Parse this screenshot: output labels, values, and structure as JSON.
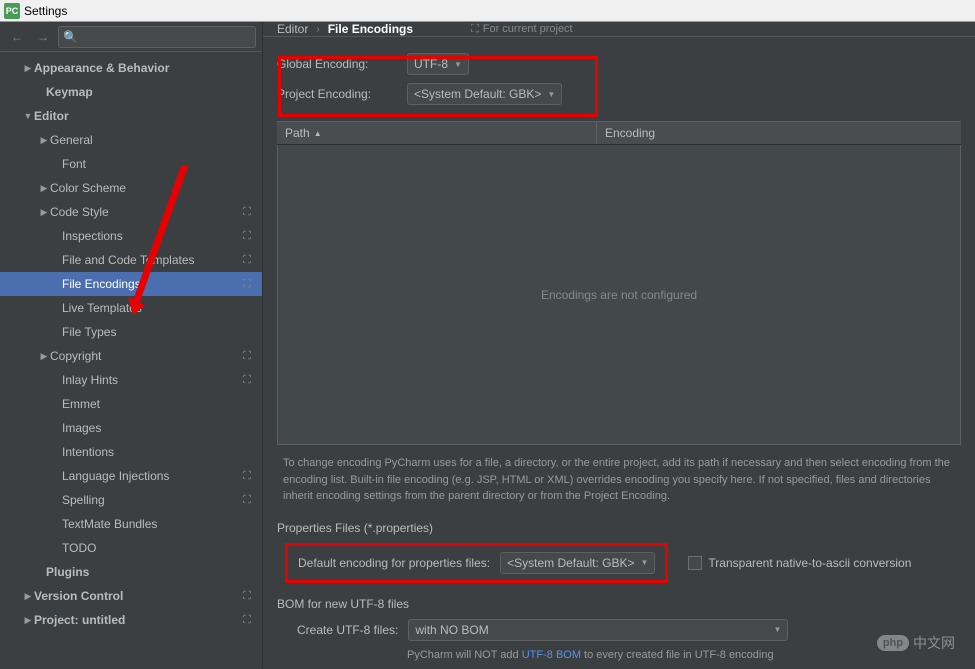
{
  "window": {
    "title": "Settings"
  },
  "search": {
    "placeholder": ""
  },
  "sidebar": {
    "items": [
      {
        "label": "Appearance & Behavior",
        "indent": 22,
        "bold": true,
        "arrow": "▶",
        "icon": ""
      },
      {
        "label": "Keymap",
        "indent": 34,
        "bold": true,
        "arrow": "",
        "icon": ""
      },
      {
        "label": "Editor",
        "indent": 22,
        "bold": true,
        "arrow": "▼",
        "icon": ""
      },
      {
        "label": "General",
        "indent": 38,
        "bold": false,
        "arrow": "▶",
        "icon": ""
      },
      {
        "label": "Font",
        "indent": 50,
        "bold": false,
        "arrow": "",
        "icon": ""
      },
      {
        "label": "Color Scheme",
        "indent": 38,
        "bold": false,
        "arrow": "▶",
        "icon": ""
      },
      {
        "label": "Code Style",
        "indent": 38,
        "bold": false,
        "arrow": "▶",
        "icon": "⛶"
      },
      {
        "label": "Inspections",
        "indent": 50,
        "bold": false,
        "arrow": "",
        "icon": "⛶"
      },
      {
        "label": "File and Code Templates",
        "indent": 50,
        "bold": false,
        "arrow": "",
        "icon": "⛶"
      },
      {
        "label": "File Encodings",
        "indent": 50,
        "bold": false,
        "arrow": "",
        "icon": "⛶",
        "selected": true
      },
      {
        "label": "Live Templates",
        "indent": 50,
        "bold": false,
        "arrow": "",
        "icon": ""
      },
      {
        "label": "File Types",
        "indent": 50,
        "bold": false,
        "arrow": "",
        "icon": ""
      },
      {
        "label": "Copyright",
        "indent": 38,
        "bold": false,
        "arrow": "▶",
        "icon": "⛶"
      },
      {
        "label": "Inlay Hints",
        "indent": 50,
        "bold": false,
        "arrow": "",
        "icon": "⛶"
      },
      {
        "label": "Emmet",
        "indent": 50,
        "bold": false,
        "arrow": "",
        "icon": ""
      },
      {
        "label": "Images",
        "indent": 50,
        "bold": false,
        "arrow": "",
        "icon": ""
      },
      {
        "label": "Intentions",
        "indent": 50,
        "bold": false,
        "arrow": "",
        "icon": ""
      },
      {
        "label": "Language Injections",
        "indent": 50,
        "bold": false,
        "arrow": "",
        "icon": "⛶"
      },
      {
        "label": "Spelling",
        "indent": 50,
        "bold": false,
        "arrow": "",
        "icon": "⛶"
      },
      {
        "label": "TextMate Bundles",
        "indent": 50,
        "bold": false,
        "arrow": "",
        "icon": ""
      },
      {
        "label": "TODO",
        "indent": 50,
        "bold": false,
        "arrow": "",
        "icon": ""
      },
      {
        "label": "Plugins",
        "indent": 34,
        "bold": true,
        "arrow": "",
        "icon": ""
      },
      {
        "label": "Version Control",
        "indent": 22,
        "bold": true,
        "arrow": "▶",
        "icon": "⛶"
      },
      {
        "label": "Project: untitled",
        "indent": 22,
        "bold": true,
        "arrow": "▶",
        "icon": "⛶"
      }
    ]
  },
  "breadcrumb": {
    "parent": "Editor",
    "current": "File Encodings",
    "hint": "For current project"
  },
  "encodings": {
    "global_label": "Global Encoding:",
    "global_value": "UTF-8",
    "project_label": "Project Encoding:",
    "project_value": "<System Default: GBK>"
  },
  "table": {
    "col_path": "Path",
    "col_encoding": "Encoding",
    "empty_text": "Encodings are not configured"
  },
  "info": "To change encoding PyCharm uses for a file, a directory, or the entire project, add its path if necessary and then select encoding from the encoding list. Built-in file encoding (e.g. JSP, HTML or XML) overrides encoding you specify here. If not specified, files and directories inherit encoding settings from the parent directory or from the Project Encoding.",
  "properties": {
    "title": "Properties Files (*.properties)",
    "label": "Default encoding for properties files:",
    "value": "<System Default: GBK>",
    "checkbox_label": "Transparent native-to-ascii conversion"
  },
  "bom": {
    "title": "BOM for new UTF-8 files",
    "label": "Create UTF-8 files:",
    "value": "with NO BOM",
    "hint_prefix": "PyCharm will NOT add ",
    "hint_link": "UTF-8 BOM",
    "hint_suffix": " to every created file in UTF-8 encoding"
  },
  "watermark": {
    "logo": "php",
    "text": "中文网"
  }
}
